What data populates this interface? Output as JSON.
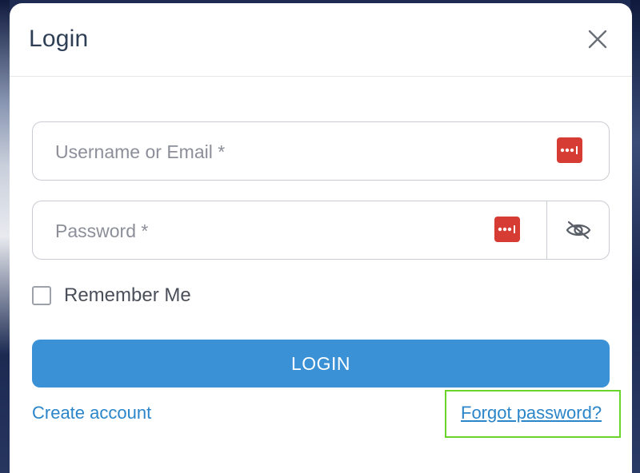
{
  "modal": {
    "title": "Login",
    "close_icon": "close-icon"
  },
  "form": {
    "username": {
      "placeholder": "Username or Email *",
      "value": "",
      "autofill_icon": "password-manager-icon"
    },
    "password": {
      "placeholder": "Password *",
      "value": "",
      "autofill_icon": "password-manager-icon",
      "visibility_icon": "eye-slash-icon"
    },
    "remember_me": {
      "label": "Remember Me",
      "checked": false
    },
    "submit_label": "LOGIN"
  },
  "links": {
    "create_account": "Create account",
    "forgot_password": "Forgot password?"
  },
  "colors": {
    "accent": "#3a91d6",
    "link": "#2b86c9",
    "password_manager": "#d63c34",
    "highlight": "#6ad42b"
  }
}
